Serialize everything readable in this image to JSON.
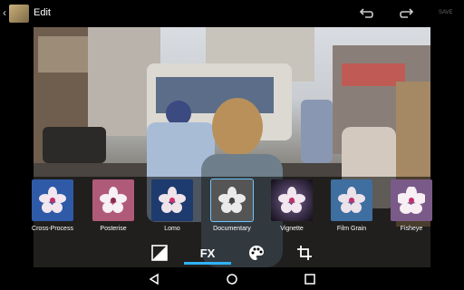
{
  "header": {
    "back_glyph": "‹",
    "title": "Edit",
    "save_label": "SAVE"
  },
  "filters": [
    {
      "label": "Cross-Process",
      "tint": "#2e5aa8"
    },
    {
      "label": "Posterise",
      "tint": "#b05a7a"
    },
    {
      "label": "Lomo",
      "tint": "#1d3b6e"
    },
    {
      "label": "Documentary",
      "tint": "#555555"
    },
    {
      "label": "Vignette",
      "tint": "#3a2f4a"
    },
    {
      "label": "Film Grain",
      "tint": "#3f6ea0"
    },
    {
      "label": "Fisheye",
      "tint": "#7a5a88"
    }
  ],
  "tabs": {
    "fx_label": "FX"
  }
}
